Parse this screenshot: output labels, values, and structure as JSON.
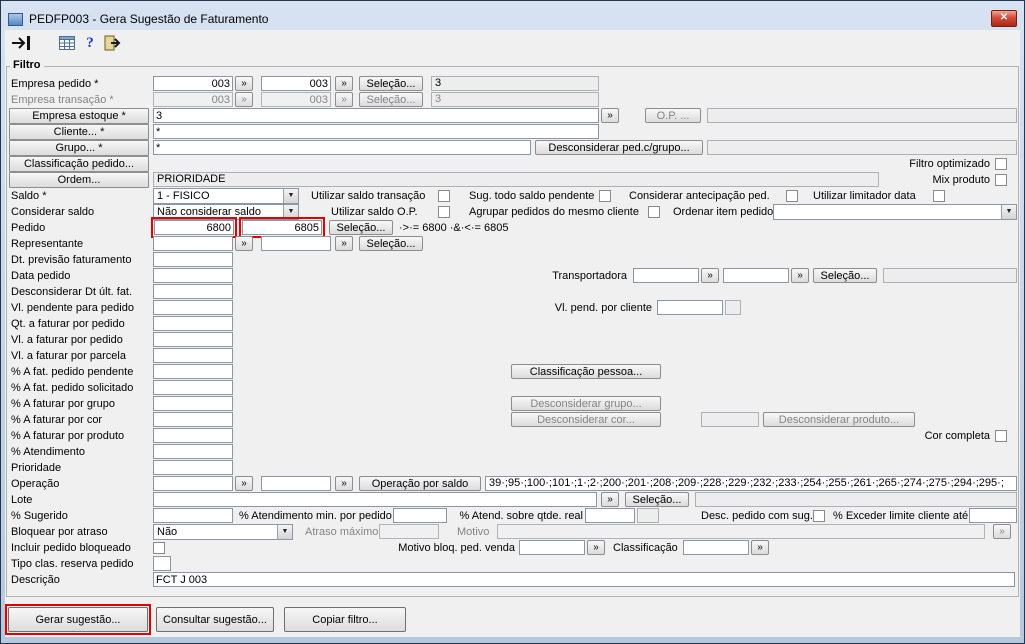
{
  "window": {
    "title": "PEDFP003 - Gera Sugestão de Faturamento"
  },
  "icons": {
    "close": "✕",
    "help": "?",
    "dropdown": "▼"
  },
  "filtro": {
    "legend": "Filtro",
    "selecao_label": "Seleção...",
    "gt_label": "»",
    "rows": {
      "empresa_pedido": {
        "label": "Empresa pedido *",
        "from": "003",
        "to": "003",
        "desc": "3"
      },
      "empresa_transacao": {
        "label": "Empresa transação *",
        "from": "003",
        "to": "003",
        "desc": "3"
      },
      "empresa_estoque": {
        "label": "Empresa estoque *",
        "value": "3",
        "op_button": "O.P. ..."
      },
      "cliente": {
        "label": "Cliente... *",
        "value": "*"
      },
      "grupo": {
        "label": "Grupo... *",
        "value": "*",
        "desconsiderar_button": "Desconsiderar ped.c/grupo..."
      },
      "classificacao_pedido": {
        "label": "Classificação pedido...",
        "filtro_optimizado": "Filtro optimizado"
      },
      "ordem": {
        "label": "Ordem...",
        "value": "PRIORIDADE",
        "mix_produto": "Mix produto"
      },
      "saldo": {
        "label": "Saldo *",
        "value": "1 - FISICO",
        "cb1": "Utilizar saldo transação",
        "cb2": "Sug. todo saldo pendente",
        "cb3": "Considerar antecipação ped.",
        "cb4": "Utilizar limitador data"
      },
      "considerar_saldo": {
        "label": "Considerar saldo",
        "value": "Não considerar saldo",
        "cb1": "Utilizar saldo O.P.",
        "cb2": "Agrupar pedidos do mesmo cliente",
        "ordenar_label": "Ordenar item pedido"
      },
      "pedido": {
        "label": "Pedido",
        "from": "6800",
        "to": "6805",
        "expr": "·>·= 6800 ·&·<·= 6805"
      },
      "representante": {
        "label": "Representante"
      },
      "dt_previsao": {
        "label": "Dt. previsão faturamento"
      },
      "data_pedido": {
        "label": "Data pedido",
        "transportadora_label": "Transportadora"
      },
      "desconsiderar_dt": {
        "label": "Desconsiderar Dt últ. fat."
      },
      "vl_pendente": {
        "label": "Vl. pendente para pedido",
        "cliente_label": "Vl. pend. por cliente"
      },
      "qt_faturar": {
        "label": "Qt. a faturar por pedido"
      },
      "vl_faturar_pedido": {
        "label": "Vl. a faturar por pedido"
      },
      "vl_faturar_parcela": {
        "label": "Vl. a faturar por parcela"
      },
      "pct_fat_pendente": {
        "label": "% A fat. pedido pendente",
        "classificacao_pessoa": "Classificação pessoa..."
      },
      "pct_fat_solicitado": {
        "label": "% A fat. pedido solicitado"
      },
      "pct_grupo": {
        "label": "% A faturar por grupo",
        "desconsiderar_grupo": "Desconsiderar grupo..."
      },
      "pct_cor": {
        "label": "% A faturar por cor",
        "desconsiderar_cor": "Desconsiderar cor...",
        "desconsiderar_produto": "Desconsiderar produto..."
      },
      "pct_produto": {
        "label": "% A faturar por produto",
        "cor_completa": "Cor completa"
      },
      "pct_atendimento": {
        "label": "% Atendimento"
      },
      "prioridade": {
        "label": "Prioridade"
      },
      "operacao": {
        "label": "Operação",
        "por_saldo_button": "Operação por saldo",
        "lista": "39·;95·;100·;101·;1·;2·;200·;201·;208·;209·;228·;229·;232·;233·;254·;255·;261·;265·;274·;275·;294·;295·;"
      },
      "lote": {
        "label": "Lote"
      },
      "pct_sugerido": {
        "label": "% Sugerido",
        "atendimento_min": "% Atendimento min. por pedido",
        "atend_qtde_real": "% Atend. sobre qtde. real",
        "desc_pedido_sug": "Desc. pedido com sug.",
        "exceder_limite": "% Exceder limite cliente até"
      },
      "bloquear_atraso": {
        "label": "Bloquear por atraso",
        "value": "Não",
        "atraso_maximo": "Atraso máximo",
        "motivo": "Motivo"
      },
      "incluir_bloqueado": {
        "label": "Incluir pedido bloqueado",
        "motivo_bloq": "Motivo bloq. ped. venda",
        "classificacao": "Classificação"
      },
      "tipo_clas": {
        "label": "Tipo clas. reserva pedido"
      },
      "descricao": {
        "label": "Descrição",
        "value": "FCT J 003"
      }
    }
  },
  "footer": {
    "gerar": "Gerar sugestão...",
    "consultar": "Consultar sugestão...",
    "copiar": "Copiar filtro..."
  }
}
